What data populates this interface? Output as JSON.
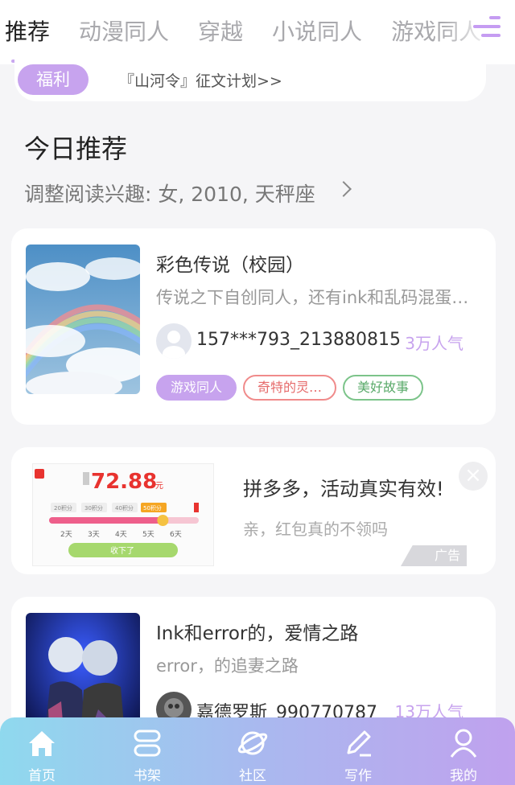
{
  "tabs": [
    "推荐",
    "动漫同人",
    "穿越",
    "小说同人",
    "游戏同人"
  ],
  "notice": {
    "badge": "福利",
    "text": "『山河令』征文计划>>"
  },
  "section": {
    "title": "今日推荐",
    "subtitle": "调整阅读兴趣: 女, 2010, 天秤座"
  },
  "books": [
    {
      "title": "彩色传说（校园）",
      "desc": "传说之下自创同人，还有ink和乱码混蛋…",
      "author": "157***793_213880815",
      "popularity": "3万人气",
      "tags": [
        "游戏同人",
        "奇特的灵…",
        "美好故事"
      ]
    },
    {
      "title": "Ink和error的，爱情之路",
      "desc": "error，的追妻之路",
      "author": "嘉德罗斯_990770787",
      "popularity": "13万人气"
    }
  ],
  "ad": {
    "title": "拼多多，活动真实有效!",
    "subtitle": "亲，红包真的不领吗",
    "label": "广告",
    "amount": "72.88",
    "amount_unit": "元",
    "steps": [
      "20积分",
      "30积分",
      "40积分",
      "50积分"
    ],
    "days": [
      "2天",
      "3天",
      "4天",
      "5天",
      "6天"
    ],
    "button": "收下了",
    "progress": 0.76
  },
  "nav": [
    "首页",
    "书架",
    "社区",
    "写作",
    "我的"
  ],
  "colors": {
    "accent": "#c7a3ee",
    "nav_gradient_start": "#8fd9ee",
    "nav_gradient_end": "#c0a1ee"
  }
}
